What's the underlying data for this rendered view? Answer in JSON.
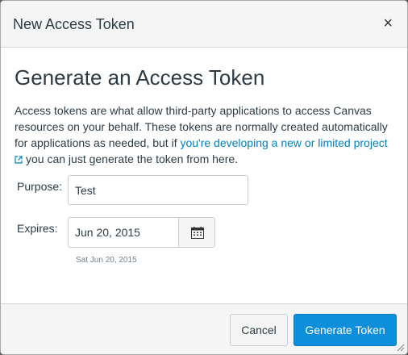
{
  "dialog": {
    "title": "New Access Token",
    "close_glyph": "×"
  },
  "content": {
    "heading": "Generate an Access Token",
    "description_before": "Access tokens are what allow third-party applications to access Canvas resources on your behalf. These tokens are normally created automatically for applications as needed, but if ",
    "description_link": "you're developing a new or limited project",
    "description_after": "you can just generate the token from here."
  },
  "form": {
    "purpose_label": "Purpose:",
    "purpose_value": "Test",
    "expires_label": "Expires:",
    "expires_value": "Jun 20, 2015",
    "expires_hint": "Sat Jun 20, 2015"
  },
  "footer": {
    "cancel_label": "Cancel",
    "generate_label": "Generate Token"
  },
  "colors": {
    "primary": "#0e8fdc",
    "link": "#0081bd",
    "text": "#2d3b45"
  },
  "icons": [
    "close-icon",
    "external-link-icon",
    "calendar-icon",
    "resize-handle-icon"
  ]
}
